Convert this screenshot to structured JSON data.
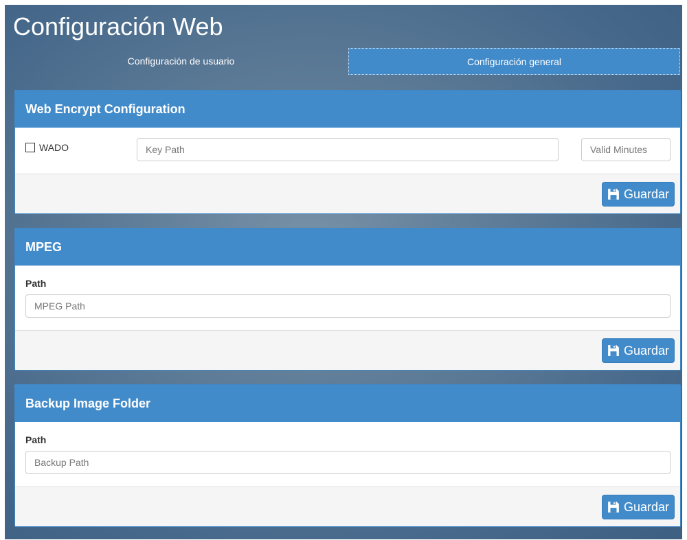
{
  "header": {
    "title": "Configuración Web"
  },
  "tabs": [
    {
      "label": "Configuración de usuario"
    },
    {
      "label": "Configuración general"
    }
  ],
  "panels": {
    "web_encrypt": {
      "title": "Web Encrypt Configuration",
      "checkbox_label": "WADO",
      "key_path_placeholder": "Key Path",
      "valid_minutes_placeholder": "Valid Minutes",
      "save_label": "Guardar"
    },
    "mpeg": {
      "title": "MPEG",
      "path_label": "Path",
      "path_placeholder": "MPEG Path",
      "save_label": "Guardar"
    },
    "backup": {
      "title": "Backup Image Folder",
      "path_label": "Path",
      "path_placeholder": "Backup Path",
      "save_label": "Guardar"
    }
  },
  "colors": {
    "accent": "#428bca",
    "background": "#4f7193",
    "footer": "#f5f5f5"
  },
  "icons": {
    "save": "floppy-disk-icon"
  }
}
